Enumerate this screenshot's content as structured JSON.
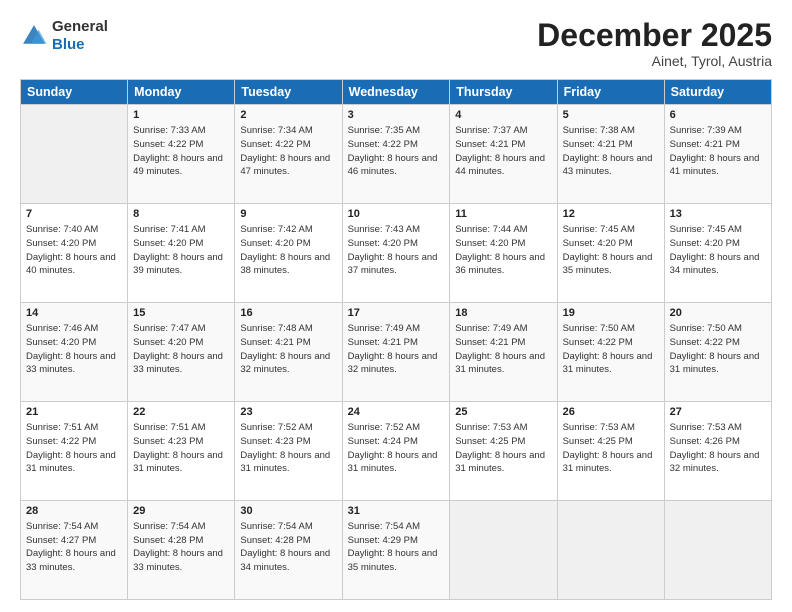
{
  "header": {
    "logo_general": "General",
    "logo_blue": "Blue",
    "month_title": "December 2025",
    "location": "Ainet, Tyrol, Austria"
  },
  "weekdays": [
    "Sunday",
    "Monday",
    "Tuesday",
    "Wednesday",
    "Thursday",
    "Friday",
    "Saturday"
  ],
  "weeks": [
    [
      {
        "day": "",
        "empty": true
      },
      {
        "day": "1",
        "sunrise": "7:33 AM",
        "sunset": "4:22 PM",
        "daylight": "8 hours and 49 minutes."
      },
      {
        "day": "2",
        "sunrise": "7:34 AM",
        "sunset": "4:22 PM",
        "daylight": "8 hours and 47 minutes."
      },
      {
        "day": "3",
        "sunrise": "7:35 AM",
        "sunset": "4:22 PM",
        "daylight": "8 hours and 46 minutes."
      },
      {
        "day": "4",
        "sunrise": "7:37 AM",
        "sunset": "4:21 PM",
        "daylight": "8 hours and 44 minutes."
      },
      {
        "day": "5",
        "sunrise": "7:38 AM",
        "sunset": "4:21 PM",
        "daylight": "8 hours and 43 minutes."
      },
      {
        "day": "6",
        "sunrise": "7:39 AM",
        "sunset": "4:21 PM",
        "daylight": "8 hours and 41 minutes."
      }
    ],
    [
      {
        "day": "7",
        "sunrise": "7:40 AM",
        "sunset": "4:20 PM",
        "daylight": "8 hours and 40 minutes."
      },
      {
        "day": "8",
        "sunrise": "7:41 AM",
        "sunset": "4:20 PM",
        "daylight": "8 hours and 39 minutes."
      },
      {
        "day": "9",
        "sunrise": "7:42 AM",
        "sunset": "4:20 PM",
        "daylight": "8 hours and 38 minutes."
      },
      {
        "day": "10",
        "sunrise": "7:43 AM",
        "sunset": "4:20 PM",
        "daylight": "8 hours and 37 minutes."
      },
      {
        "day": "11",
        "sunrise": "7:44 AM",
        "sunset": "4:20 PM",
        "daylight": "8 hours and 36 minutes."
      },
      {
        "day": "12",
        "sunrise": "7:45 AM",
        "sunset": "4:20 PM",
        "daylight": "8 hours and 35 minutes."
      },
      {
        "day": "13",
        "sunrise": "7:45 AM",
        "sunset": "4:20 PM",
        "daylight": "8 hours and 34 minutes."
      }
    ],
    [
      {
        "day": "14",
        "sunrise": "7:46 AM",
        "sunset": "4:20 PM",
        "daylight": "8 hours and 33 minutes."
      },
      {
        "day": "15",
        "sunrise": "7:47 AM",
        "sunset": "4:20 PM",
        "daylight": "8 hours and 33 minutes."
      },
      {
        "day": "16",
        "sunrise": "7:48 AM",
        "sunset": "4:21 PM",
        "daylight": "8 hours and 32 minutes."
      },
      {
        "day": "17",
        "sunrise": "7:49 AM",
        "sunset": "4:21 PM",
        "daylight": "8 hours and 32 minutes."
      },
      {
        "day": "18",
        "sunrise": "7:49 AM",
        "sunset": "4:21 PM",
        "daylight": "8 hours and 31 minutes."
      },
      {
        "day": "19",
        "sunrise": "7:50 AM",
        "sunset": "4:22 PM",
        "daylight": "8 hours and 31 minutes."
      },
      {
        "day": "20",
        "sunrise": "7:50 AM",
        "sunset": "4:22 PM",
        "daylight": "8 hours and 31 minutes."
      }
    ],
    [
      {
        "day": "21",
        "sunrise": "7:51 AM",
        "sunset": "4:22 PM",
        "daylight": "8 hours and 31 minutes."
      },
      {
        "day": "22",
        "sunrise": "7:51 AM",
        "sunset": "4:23 PM",
        "daylight": "8 hours and 31 minutes."
      },
      {
        "day": "23",
        "sunrise": "7:52 AM",
        "sunset": "4:23 PM",
        "daylight": "8 hours and 31 minutes."
      },
      {
        "day": "24",
        "sunrise": "7:52 AM",
        "sunset": "4:24 PM",
        "daylight": "8 hours and 31 minutes."
      },
      {
        "day": "25",
        "sunrise": "7:53 AM",
        "sunset": "4:25 PM",
        "daylight": "8 hours and 31 minutes."
      },
      {
        "day": "26",
        "sunrise": "7:53 AM",
        "sunset": "4:25 PM",
        "daylight": "8 hours and 31 minutes."
      },
      {
        "day": "27",
        "sunrise": "7:53 AM",
        "sunset": "4:26 PM",
        "daylight": "8 hours and 32 minutes."
      }
    ],
    [
      {
        "day": "28",
        "sunrise": "7:54 AM",
        "sunset": "4:27 PM",
        "daylight": "8 hours and 33 minutes."
      },
      {
        "day": "29",
        "sunrise": "7:54 AM",
        "sunset": "4:28 PM",
        "daylight": "8 hours and 33 minutes."
      },
      {
        "day": "30",
        "sunrise": "7:54 AM",
        "sunset": "4:28 PM",
        "daylight": "8 hours and 34 minutes."
      },
      {
        "day": "31",
        "sunrise": "7:54 AM",
        "sunset": "4:29 PM",
        "daylight": "8 hours and 35 minutes."
      },
      {
        "day": "",
        "empty": true
      },
      {
        "day": "",
        "empty": true
      },
      {
        "day": "",
        "empty": true
      }
    ]
  ]
}
